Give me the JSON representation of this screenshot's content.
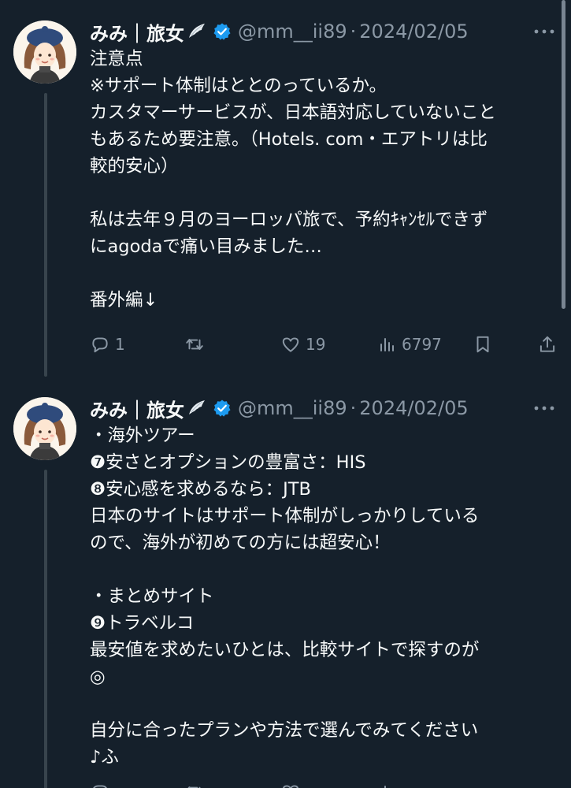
{
  "tweets": [
    {
      "author": {
        "display_name": "みみ｜旅女",
        "handle": "@mm__ii89",
        "verified": true
      },
      "separator": "·",
      "date": "2024/02/05",
      "lines": [
        "注意点",
        "※サポート体制はととのっているか。",
        "カスタマーサービスが、日本語対応していないこと",
        "もあるため要注意。（Hotels. com・エアトリは比",
        "較的安心）",
        "",
        "私は去年９月のヨーロッパ旅で、予約ｷｬﾝｾﾙできず",
        "にagodaで痛い目みました…",
        "",
        "番外編↓"
      ],
      "stats": {
        "replies": "1",
        "retweets": "",
        "likes": "19",
        "views": "6797"
      }
    },
    {
      "author": {
        "display_name": "みみ｜旅女",
        "handle": "@mm__ii89",
        "verified": true
      },
      "separator": "·",
      "date": "2024/02/05",
      "lines": [
        "・海外ツアー",
        "❼安さとオプションの豊富さ：HIS",
        "❽安心感を求めるなら：JTB",
        "日本のサイトはサポート体制がしっかりしている",
        "ので、海外が初めての方には超安心！",
        "",
        "・まとめサイト",
        "❾トラベルコ",
        "最安値を求めたいひとは、比較サイトで探すのが",
        "◎",
        "",
        "自分に合ったプランや方法で選んでみてください",
        "♪ふ"
      ]
    }
  ],
  "icons": {
    "more": "more-horizontal-icon",
    "reply": "reply-icon",
    "retweet": "retweet-icon",
    "like": "heart-icon",
    "views": "views-icon",
    "bookmark": "bookmark-icon",
    "share": "share-icon",
    "verified": "verified-badge-icon",
    "wing": "angel-wing-icon"
  },
  "colors": {
    "background": "#15202b",
    "text": "#f7f9f9",
    "muted": "#8b98a5",
    "verified": "#1d9bf0",
    "thread_line": "#38444d"
  }
}
